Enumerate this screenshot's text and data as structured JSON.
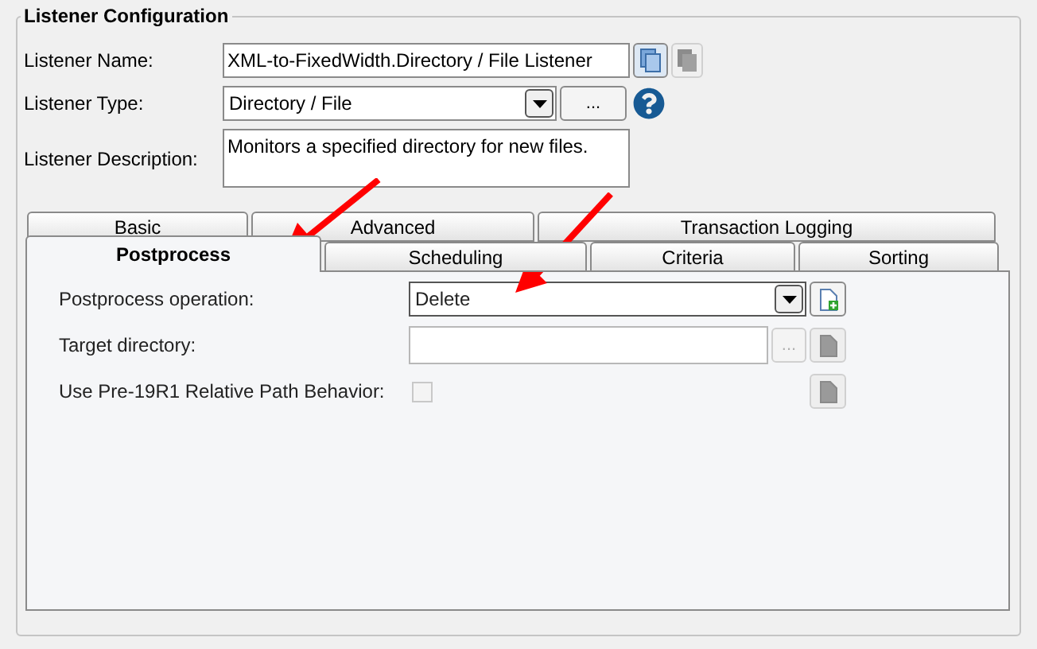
{
  "section": {
    "title": "Listener Configuration"
  },
  "listener_name": {
    "label": "Listener Name:",
    "value": "XML-to-FixedWidth.Directory / File Listener",
    "copy_button": {
      "disabled": false
    },
    "paste_button": {
      "disabled": true
    }
  },
  "listener_type": {
    "label": "Listener Type:",
    "value": "Directory / File",
    "browse_button": {
      "label": "...",
      "disabled": false
    }
  },
  "listener_description": {
    "label": "Listener Description:",
    "value": "Monitors a specified directory for new files."
  },
  "tab_rows": [
    {
      "tabs": [
        {
          "label": "Basic",
          "selected": false
        },
        {
          "label": "Advanced",
          "selected": false
        },
        {
          "label": "Transaction Logging",
          "selected": false
        }
      ]
    },
    {
      "tabs": [
        {
          "label": "Postprocess",
          "selected": true
        },
        {
          "label": "Scheduling",
          "selected": false
        },
        {
          "label": "Criteria",
          "selected": false
        },
        {
          "label": "Sorting",
          "selected": false
        }
      ]
    }
  ],
  "postprocess": {
    "rows": [
      {
        "kind": "select",
        "label": "Postprocess operation:",
        "value": "Delete",
        "action_disabled": false
      },
      {
        "kind": "text",
        "label": "Target directory:",
        "browse_button": {
          "label": "...",
          "disabled": true
        },
        "action_disabled": true
      },
      {
        "kind": "checkbox",
        "label": "Use Pre-19R1 Relative Path Behavior:",
        "checked": false,
        "disabled": true,
        "action_disabled": true
      }
    ]
  }
}
